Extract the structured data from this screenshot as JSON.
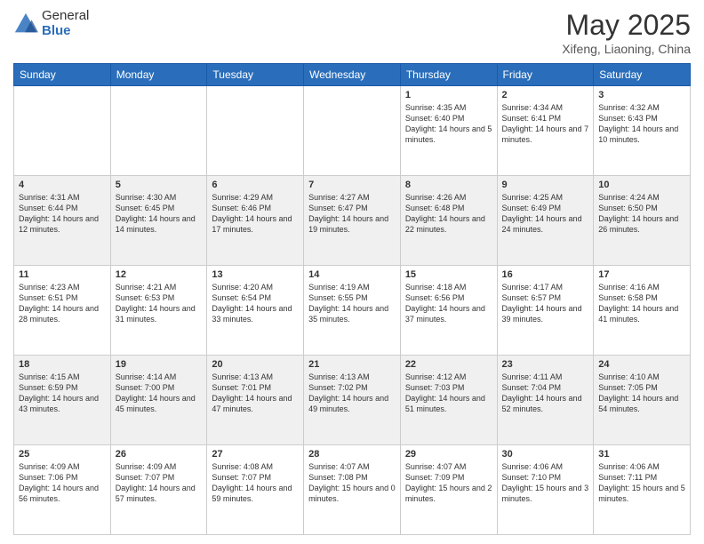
{
  "header": {
    "logo_general": "General",
    "logo_blue": "Blue",
    "month_title": "May 2025",
    "location": "Xifeng, Liaoning, China"
  },
  "days_of_week": [
    "Sunday",
    "Monday",
    "Tuesday",
    "Wednesday",
    "Thursday",
    "Friday",
    "Saturday"
  ],
  "weeks": [
    [
      {
        "num": "",
        "content": ""
      },
      {
        "num": "",
        "content": ""
      },
      {
        "num": "",
        "content": ""
      },
      {
        "num": "",
        "content": ""
      },
      {
        "num": "1",
        "content": "Sunrise: 4:35 AM\nSunset: 6:40 PM\nDaylight: 14 hours\nand 5 minutes."
      },
      {
        "num": "2",
        "content": "Sunrise: 4:34 AM\nSunset: 6:41 PM\nDaylight: 14 hours\nand 7 minutes."
      },
      {
        "num": "3",
        "content": "Sunrise: 4:32 AM\nSunset: 6:43 PM\nDaylight: 14 hours\nand 10 minutes."
      }
    ],
    [
      {
        "num": "4",
        "content": "Sunrise: 4:31 AM\nSunset: 6:44 PM\nDaylight: 14 hours\nand 12 minutes."
      },
      {
        "num": "5",
        "content": "Sunrise: 4:30 AM\nSunset: 6:45 PM\nDaylight: 14 hours\nand 14 minutes."
      },
      {
        "num": "6",
        "content": "Sunrise: 4:29 AM\nSunset: 6:46 PM\nDaylight: 14 hours\nand 17 minutes."
      },
      {
        "num": "7",
        "content": "Sunrise: 4:27 AM\nSunset: 6:47 PM\nDaylight: 14 hours\nand 19 minutes."
      },
      {
        "num": "8",
        "content": "Sunrise: 4:26 AM\nSunset: 6:48 PM\nDaylight: 14 hours\nand 22 minutes."
      },
      {
        "num": "9",
        "content": "Sunrise: 4:25 AM\nSunset: 6:49 PM\nDaylight: 14 hours\nand 24 minutes."
      },
      {
        "num": "10",
        "content": "Sunrise: 4:24 AM\nSunset: 6:50 PM\nDaylight: 14 hours\nand 26 minutes."
      }
    ],
    [
      {
        "num": "11",
        "content": "Sunrise: 4:23 AM\nSunset: 6:51 PM\nDaylight: 14 hours\nand 28 minutes."
      },
      {
        "num": "12",
        "content": "Sunrise: 4:21 AM\nSunset: 6:53 PM\nDaylight: 14 hours\nand 31 minutes."
      },
      {
        "num": "13",
        "content": "Sunrise: 4:20 AM\nSunset: 6:54 PM\nDaylight: 14 hours\nand 33 minutes."
      },
      {
        "num": "14",
        "content": "Sunrise: 4:19 AM\nSunset: 6:55 PM\nDaylight: 14 hours\nand 35 minutes."
      },
      {
        "num": "15",
        "content": "Sunrise: 4:18 AM\nSunset: 6:56 PM\nDaylight: 14 hours\nand 37 minutes."
      },
      {
        "num": "16",
        "content": "Sunrise: 4:17 AM\nSunset: 6:57 PM\nDaylight: 14 hours\nand 39 minutes."
      },
      {
        "num": "17",
        "content": "Sunrise: 4:16 AM\nSunset: 6:58 PM\nDaylight: 14 hours\nand 41 minutes."
      }
    ],
    [
      {
        "num": "18",
        "content": "Sunrise: 4:15 AM\nSunset: 6:59 PM\nDaylight: 14 hours\nand 43 minutes."
      },
      {
        "num": "19",
        "content": "Sunrise: 4:14 AM\nSunset: 7:00 PM\nDaylight: 14 hours\nand 45 minutes."
      },
      {
        "num": "20",
        "content": "Sunrise: 4:13 AM\nSunset: 7:01 PM\nDaylight: 14 hours\nand 47 minutes."
      },
      {
        "num": "21",
        "content": "Sunrise: 4:13 AM\nSunset: 7:02 PM\nDaylight: 14 hours\nand 49 minutes."
      },
      {
        "num": "22",
        "content": "Sunrise: 4:12 AM\nSunset: 7:03 PM\nDaylight: 14 hours\nand 51 minutes."
      },
      {
        "num": "23",
        "content": "Sunrise: 4:11 AM\nSunset: 7:04 PM\nDaylight: 14 hours\nand 52 minutes."
      },
      {
        "num": "24",
        "content": "Sunrise: 4:10 AM\nSunset: 7:05 PM\nDaylight: 14 hours\nand 54 minutes."
      }
    ],
    [
      {
        "num": "25",
        "content": "Sunrise: 4:09 AM\nSunset: 7:06 PM\nDaylight: 14 hours\nand 56 minutes."
      },
      {
        "num": "26",
        "content": "Sunrise: 4:09 AM\nSunset: 7:07 PM\nDaylight: 14 hours\nand 57 minutes."
      },
      {
        "num": "27",
        "content": "Sunrise: 4:08 AM\nSunset: 7:07 PM\nDaylight: 14 hours\nand 59 minutes."
      },
      {
        "num": "28",
        "content": "Sunrise: 4:07 AM\nSunset: 7:08 PM\nDaylight: 15 hours\nand 0 minutes."
      },
      {
        "num": "29",
        "content": "Sunrise: 4:07 AM\nSunset: 7:09 PM\nDaylight: 15 hours\nand 2 minutes."
      },
      {
        "num": "30",
        "content": "Sunrise: 4:06 AM\nSunset: 7:10 PM\nDaylight: 15 hours\nand 3 minutes."
      },
      {
        "num": "31",
        "content": "Sunrise: 4:06 AM\nSunset: 7:11 PM\nDaylight: 15 hours\nand 5 minutes."
      }
    ]
  ]
}
